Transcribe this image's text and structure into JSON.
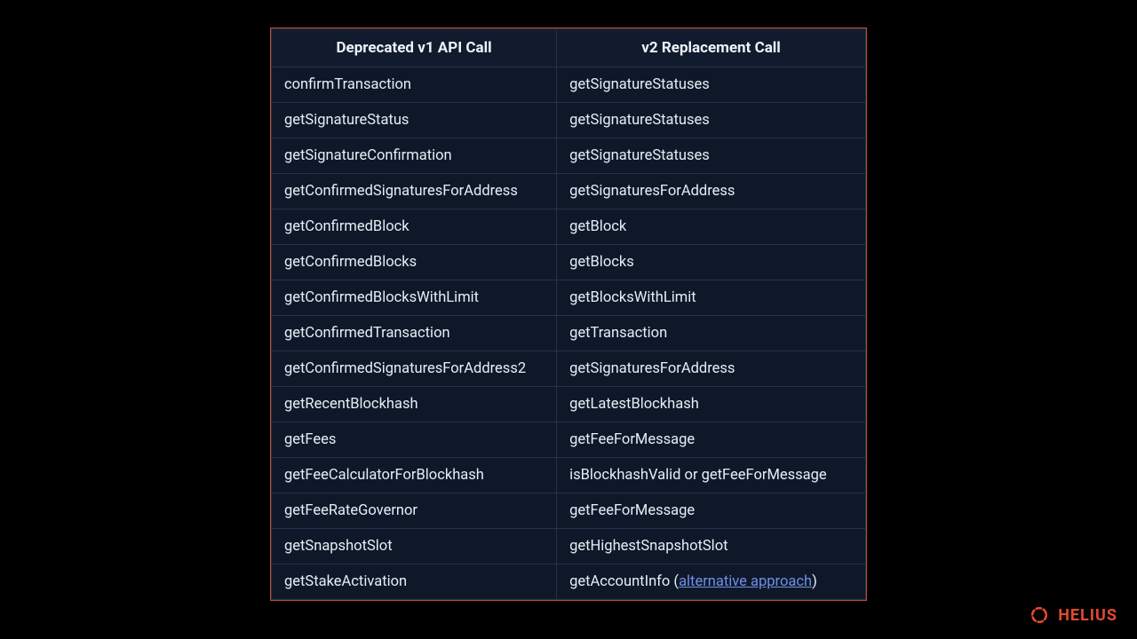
{
  "table": {
    "headers": [
      "Deprecated v1 API Call",
      "v2 Replacement Call"
    ],
    "rows": [
      {
        "deprecated": "confirmTransaction",
        "replacement": "getSignatureStatuses"
      },
      {
        "deprecated": "getSignatureStatus",
        "replacement": "getSignatureStatuses"
      },
      {
        "deprecated": "getSignatureConfirmation",
        "replacement": "getSignatureStatuses"
      },
      {
        "deprecated": "getConfirmedSignaturesForAddress",
        "replacement": "getSignaturesForAddress"
      },
      {
        "deprecated": "getConfirmedBlock",
        "replacement": "getBlock"
      },
      {
        "deprecated": "getConfirmedBlocks",
        "replacement": "getBlocks"
      },
      {
        "deprecated": "getConfirmedBlocksWithLimit",
        "replacement": "getBlocksWithLimit"
      },
      {
        "deprecated": "getConfirmedTransaction",
        "replacement": "getTransaction"
      },
      {
        "deprecated": "getConfirmedSignaturesForAddress2",
        "replacement": "getSignaturesForAddress"
      },
      {
        "deprecated": "getRecentBlockhash",
        "replacement": "getLatestBlockhash"
      },
      {
        "deprecated": "getFees",
        "replacement": "getFeeForMessage"
      },
      {
        "deprecated": "getFeeCalculatorForBlockhash",
        "replacement": "isBlockhashValid or getFeeForMessage"
      },
      {
        "deprecated": "getFeeRateGovernor",
        "replacement": "getFeeForMessage"
      },
      {
        "deprecated": "getSnapshotSlot",
        "replacement": "getHighestSnapshotSlot"
      },
      {
        "deprecated": "getStakeActivation",
        "replacement_prefix": "getAccountInfo (",
        "replacement_link": "alternative approach",
        "replacement_suffix": ")"
      }
    ]
  },
  "brand": {
    "name": "HELIUS"
  },
  "colors": {
    "brand": "#e2492f",
    "border": "#c84a2a"
  }
}
